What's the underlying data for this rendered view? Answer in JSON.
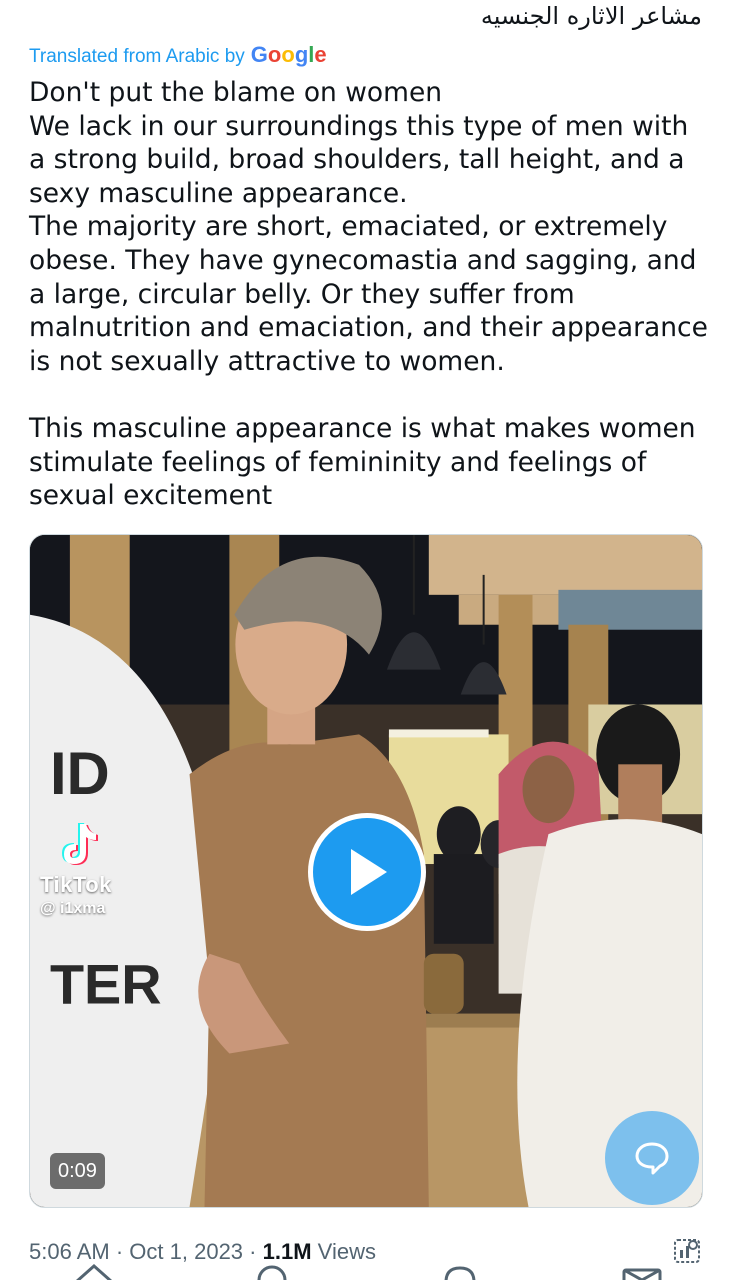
{
  "tweet": {
    "original_arabic": "مشاعر الاثاره الجنسيه",
    "translation_label": "Translated from Arabic by",
    "translation_provider": "Google",
    "paragraph_1": {
      "line_1": "Don't put the blame on women",
      "line_2": "We lack in our surroundings this type of men with a strong build, broad shoulders, tall height, and a sexy masculine appearance.",
      "line_3": "The majority are short, emaciated, or extremely obese. They have gynecomastia and sagging, and a large, circular belly. Or they suffer from malnutrition and emaciation, and their appearance is not sexually attractive to women."
    },
    "paragraph_2": "This masculine appearance is what makes women stimulate feelings of femininity and feelings of sexual excitement"
  },
  "media": {
    "type": "video",
    "watermark_app": "TikTok",
    "watermark_handle": "@ i1xma",
    "duration": "0:09",
    "play_icon": "play-icon"
  },
  "meta": {
    "time": "5:06 AM",
    "separator": "·",
    "date": "Oct 1, 2023",
    "views_count": "1.1M",
    "views_label": "Views"
  },
  "colors": {
    "accent": "#1d9bf0",
    "text": "#0f1419",
    "secondary_text": "#536471"
  },
  "icons": [
    "play-icon",
    "tiktok-icon",
    "reply-bubble-icon",
    "analytics-icon",
    "home-icon",
    "search-icon",
    "notifications-icon",
    "messages-icon"
  ]
}
